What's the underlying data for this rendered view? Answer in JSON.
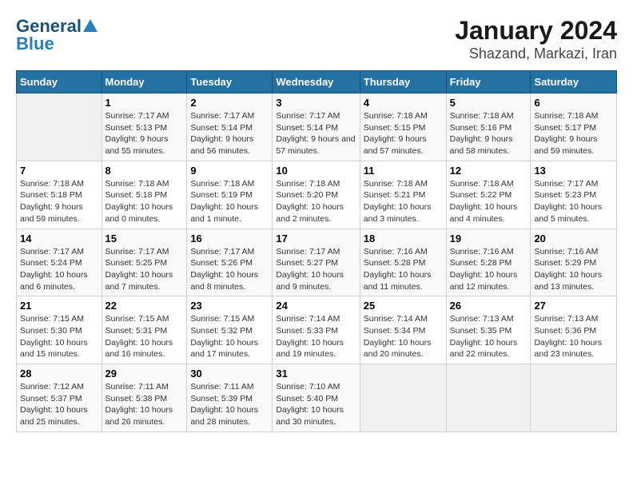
{
  "header": {
    "logo_line1": "General",
    "logo_line2": "Blue",
    "title": "January 2024",
    "subtitle": "Shazand, Markazi, Iran"
  },
  "weekdays": [
    "Sunday",
    "Monday",
    "Tuesday",
    "Wednesday",
    "Thursday",
    "Friday",
    "Saturday"
  ],
  "weeks": [
    [
      {
        "day": "",
        "sunrise": "",
        "sunset": "",
        "daylight": "",
        "empty": true
      },
      {
        "day": "1",
        "sunrise": "Sunrise: 7:17 AM",
        "sunset": "Sunset: 5:13 PM",
        "daylight": "Daylight: 9 hours and 55 minutes."
      },
      {
        "day": "2",
        "sunrise": "Sunrise: 7:17 AM",
        "sunset": "Sunset: 5:14 PM",
        "daylight": "Daylight: 9 hours and 56 minutes."
      },
      {
        "day": "3",
        "sunrise": "Sunrise: 7:17 AM",
        "sunset": "Sunset: 5:14 PM",
        "daylight": "Daylight: 9 hours and 57 minutes."
      },
      {
        "day": "4",
        "sunrise": "Sunrise: 7:18 AM",
        "sunset": "Sunset: 5:15 PM",
        "daylight": "Daylight: 9 hours and 57 minutes."
      },
      {
        "day": "5",
        "sunrise": "Sunrise: 7:18 AM",
        "sunset": "Sunset: 5:16 PM",
        "daylight": "Daylight: 9 hours and 58 minutes."
      },
      {
        "day": "6",
        "sunrise": "Sunrise: 7:18 AM",
        "sunset": "Sunset: 5:17 PM",
        "daylight": "Daylight: 9 hours and 59 minutes."
      }
    ],
    [
      {
        "day": "7",
        "sunrise": "Sunrise: 7:18 AM",
        "sunset": "Sunset: 5:18 PM",
        "daylight": "Daylight: 9 hours and 59 minutes."
      },
      {
        "day": "8",
        "sunrise": "Sunrise: 7:18 AM",
        "sunset": "Sunset: 5:18 PM",
        "daylight": "Daylight: 10 hours and 0 minutes."
      },
      {
        "day": "9",
        "sunrise": "Sunrise: 7:18 AM",
        "sunset": "Sunset: 5:19 PM",
        "daylight": "Daylight: 10 hours and 1 minute."
      },
      {
        "day": "10",
        "sunrise": "Sunrise: 7:18 AM",
        "sunset": "Sunset: 5:20 PM",
        "daylight": "Daylight: 10 hours and 2 minutes."
      },
      {
        "day": "11",
        "sunrise": "Sunrise: 7:18 AM",
        "sunset": "Sunset: 5:21 PM",
        "daylight": "Daylight: 10 hours and 3 minutes."
      },
      {
        "day": "12",
        "sunrise": "Sunrise: 7:18 AM",
        "sunset": "Sunset: 5:22 PM",
        "daylight": "Daylight: 10 hours and 4 minutes."
      },
      {
        "day": "13",
        "sunrise": "Sunrise: 7:17 AM",
        "sunset": "Sunset: 5:23 PM",
        "daylight": "Daylight: 10 hours and 5 minutes."
      }
    ],
    [
      {
        "day": "14",
        "sunrise": "Sunrise: 7:17 AM",
        "sunset": "Sunset: 5:24 PM",
        "daylight": "Daylight: 10 hours and 6 minutes."
      },
      {
        "day": "15",
        "sunrise": "Sunrise: 7:17 AM",
        "sunset": "Sunset: 5:25 PM",
        "daylight": "Daylight: 10 hours and 7 minutes."
      },
      {
        "day": "16",
        "sunrise": "Sunrise: 7:17 AM",
        "sunset": "Sunset: 5:26 PM",
        "daylight": "Daylight: 10 hours and 8 minutes."
      },
      {
        "day": "17",
        "sunrise": "Sunrise: 7:17 AM",
        "sunset": "Sunset: 5:27 PM",
        "daylight": "Daylight: 10 hours and 9 minutes."
      },
      {
        "day": "18",
        "sunrise": "Sunrise: 7:16 AM",
        "sunset": "Sunset: 5:28 PM",
        "daylight": "Daylight: 10 hours and 11 minutes."
      },
      {
        "day": "19",
        "sunrise": "Sunrise: 7:16 AM",
        "sunset": "Sunset: 5:28 PM",
        "daylight": "Daylight: 10 hours and 12 minutes."
      },
      {
        "day": "20",
        "sunrise": "Sunrise: 7:16 AM",
        "sunset": "Sunset: 5:29 PM",
        "daylight": "Daylight: 10 hours and 13 minutes."
      }
    ],
    [
      {
        "day": "21",
        "sunrise": "Sunrise: 7:15 AM",
        "sunset": "Sunset: 5:30 PM",
        "daylight": "Daylight: 10 hours and 15 minutes."
      },
      {
        "day": "22",
        "sunrise": "Sunrise: 7:15 AM",
        "sunset": "Sunset: 5:31 PM",
        "daylight": "Daylight: 10 hours and 16 minutes."
      },
      {
        "day": "23",
        "sunrise": "Sunrise: 7:15 AM",
        "sunset": "Sunset: 5:32 PM",
        "daylight": "Daylight: 10 hours and 17 minutes."
      },
      {
        "day": "24",
        "sunrise": "Sunrise: 7:14 AM",
        "sunset": "Sunset: 5:33 PM",
        "daylight": "Daylight: 10 hours and 19 minutes."
      },
      {
        "day": "25",
        "sunrise": "Sunrise: 7:14 AM",
        "sunset": "Sunset: 5:34 PM",
        "daylight": "Daylight: 10 hours and 20 minutes."
      },
      {
        "day": "26",
        "sunrise": "Sunrise: 7:13 AM",
        "sunset": "Sunset: 5:35 PM",
        "daylight": "Daylight: 10 hours and 22 minutes."
      },
      {
        "day": "27",
        "sunrise": "Sunrise: 7:13 AM",
        "sunset": "Sunset: 5:36 PM",
        "daylight": "Daylight: 10 hours and 23 minutes."
      }
    ],
    [
      {
        "day": "28",
        "sunrise": "Sunrise: 7:12 AM",
        "sunset": "Sunset: 5:37 PM",
        "daylight": "Daylight: 10 hours and 25 minutes."
      },
      {
        "day": "29",
        "sunrise": "Sunrise: 7:11 AM",
        "sunset": "Sunset: 5:38 PM",
        "daylight": "Daylight: 10 hours and 26 minutes."
      },
      {
        "day": "30",
        "sunrise": "Sunrise: 7:11 AM",
        "sunset": "Sunset: 5:39 PM",
        "daylight": "Daylight: 10 hours and 28 minutes."
      },
      {
        "day": "31",
        "sunrise": "Sunrise: 7:10 AM",
        "sunset": "Sunset: 5:40 PM",
        "daylight": "Daylight: 10 hours and 30 minutes."
      },
      {
        "day": "",
        "sunrise": "",
        "sunset": "",
        "daylight": "",
        "empty": true
      },
      {
        "day": "",
        "sunrise": "",
        "sunset": "",
        "daylight": "",
        "empty": true
      },
      {
        "day": "",
        "sunrise": "",
        "sunset": "",
        "daylight": "",
        "empty": true
      }
    ]
  ]
}
